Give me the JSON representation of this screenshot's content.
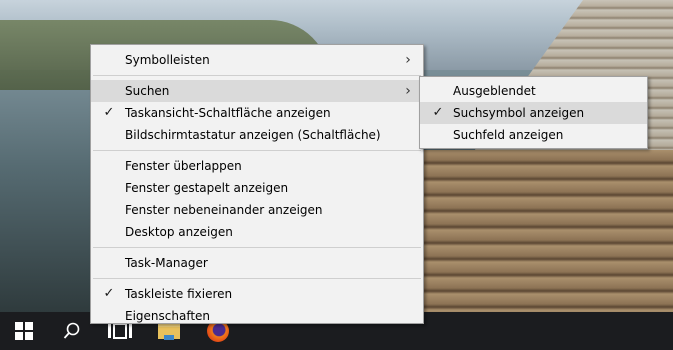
{
  "main_menu": {
    "items": [
      {
        "label": "Symbolleisten",
        "checked": false,
        "has_submenu": true
      },
      {
        "label": "Suchen",
        "checked": false,
        "has_submenu": true,
        "highlighted": true
      },
      {
        "label": "Taskansicht-Schaltfläche anzeigen",
        "checked": true
      },
      {
        "label": "Bildschirmtastatur anzeigen (Schaltfläche)",
        "checked": false
      },
      {
        "label": "Fenster überlappen",
        "checked": false
      },
      {
        "label": "Fenster gestapelt anzeigen",
        "checked": false
      },
      {
        "label": "Fenster nebeneinander anzeigen",
        "checked": false
      },
      {
        "label": "Desktop anzeigen",
        "checked": false
      },
      {
        "label": "Task-Manager",
        "checked": false
      },
      {
        "label": "Taskleiste fixieren",
        "checked": true
      },
      {
        "label": "Eigenschaften",
        "checked": false
      }
    ]
  },
  "sub_menu": {
    "items": [
      {
        "label": "Ausgeblendet",
        "checked": false
      },
      {
        "label": "Suchsymbol anzeigen",
        "checked": true,
        "highlighted": true
      },
      {
        "label": "Suchfeld anzeigen",
        "checked": false
      }
    ]
  },
  "glyphs": {
    "check": "✓",
    "arrow": "›"
  },
  "taskbar": {
    "icons": [
      "windows-start-icon",
      "search-icon",
      "task-view-icon",
      "file-explorer-icon",
      "firefox-icon"
    ],
    "background": "#1b1c1f"
  },
  "colors": {
    "menu_background": "#f2f2f2",
    "menu_highlight": "#dadada",
    "menu_border": "#a0a0a0"
  }
}
